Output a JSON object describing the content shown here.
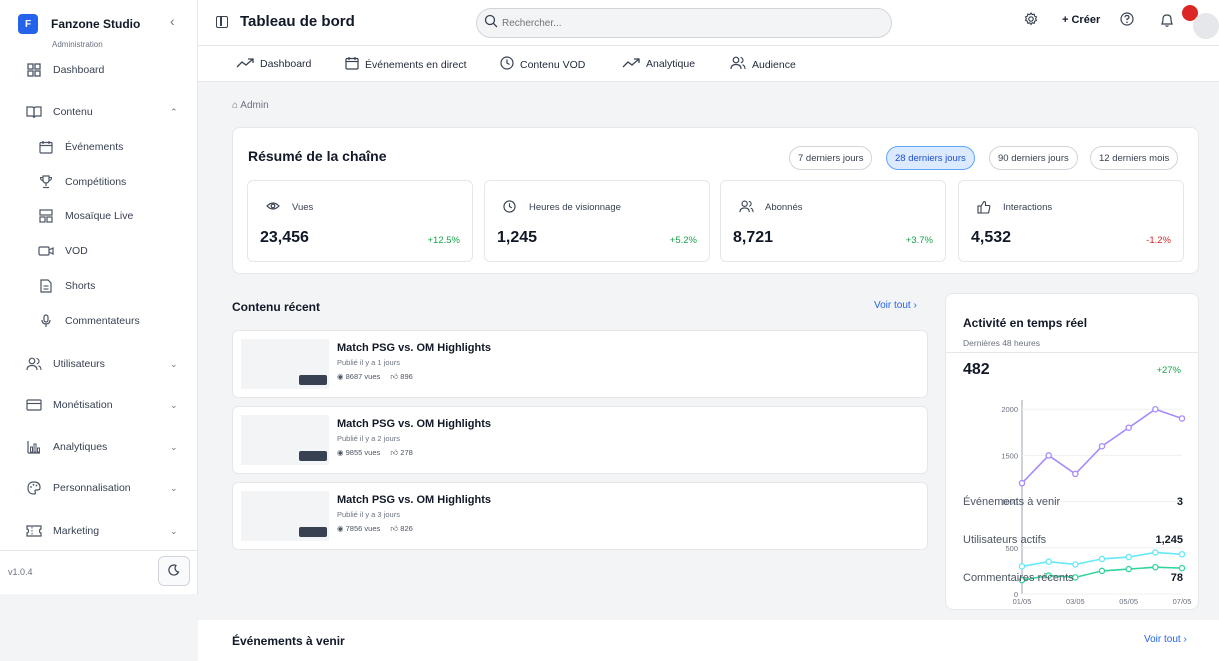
{
  "app": {
    "logo_letter": "F",
    "name": "Fanzone Studio",
    "subtitle": "Administration",
    "version": "v1.0.4"
  },
  "sidebar": {
    "items": [
      {
        "label": "Dashboard"
      },
      {
        "label": "Contenu"
      },
      {
        "label": "Événements"
      },
      {
        "label": "Compétitions"
      },
      {
        "label": "Mosaïque Live"
      },
      {
        "label": "VOD"
      },
      {
        "label": "Shorts"
      },
      {
        "label": "Commentateurs"
      },
      {
        "label": "Utilisateurs"
      },
      {
        "label": "Monétisation"
      },
      {
        "label": "Analytiques"
      },
      {
        "label": "Personnalisation"
      },
      {
        "label": "Marketing"
      }
    ]
  },
  "header": {
    "title": "Tableau de bord",
    "search_placeholder": "Rechercher...",
    "create_label": "+ Créer"
  },
  "tabs": [
    {
      "label": "Dashboard"
    },
    {
      "label": "Événements en direct"
    },
    {
      "label": "Contenu VOD"
    },
    {
      "label": "Analytique"
    },
    {
      "label": "Audience"
    }
  ],
  "breadcrumb": "Admin",
  "summary": {
    "title": "Résumé de la chaîne",
    "ranges": [
      "7 derniers jours",
      "28 derniers jours",
      "90 derniers jours",
      "12 derniers mois"
    ],
    "active_range": "28 derniers jours",
    "stats": [
      {
        "label": "Vues",
        "value": "23,456",
        "change": "+12.5%"
      },
      {
        "label": "Heures de visionnage",
        "value": "1,245",
        "change": "+5.2%"
      },
      {
        "label": "Abonnés",
        "value": "8,721",
        "change": "+3.7%"
      },
      {
        "label": "Interactions",
        "value": "4,532",
        "change": "-1.2%"
      }
    ]
  },
  "recent": {
    "title": "Contenu récent",
    "see_all": "Voir tout ›",
    "items": [
      {
        "title": "Match PSG vs. OM Highlights",
        "date": "Publié il y a 1 jours",
        "views": "8687 vues",
        "likes": "896"
      },
      {
        "title": "Match PSG vs. OM Highlights",
        "date": "Publié il y a 2 jours",
        "views": "9855 vues",
        "likes": "278"
      },
      {
        "title": "Match PSG vs. OM Highlights",
        "date": "Publié il y a 3 jours",
        "views": "7856 vues",
        "likes": "826"
      }
    ]
  },
  "activity": {
    "title": "Activité en temps réel",
    "subtitle": "Dernières 48 heures",
    "value": "482",
    "change": "+27%",
    "rows": [
      {
        "label": "Événements à venir",
        "value": "3"
      },
      {
        "label": "Utilisateurs actifs",
        "value": "1,245"
      },
      {
        "label": "Commentaires récents",
        "value": "78"
      }
    ]
  },
  "upcoming": {
    "title": "Événements à venir",
    "see_all": "Voir tout ›"
  },
  "colors": {
    "accent": "#2563eb",
    "positive": "#16a34a",
    "negative": "#dc2626",
    "series_purple": "#a78bfa",
    "series_cyan": "#67e8f9",
    "series_green": "#34d399"
  },
  "chart_data": {
    "type": "line",
    "x": [
      "01/05",
      "02/05",
      "03/05",
      "04/05",
      "05/05",
      "06/05",
      "07/05"
    ],
    "x_tick_labels": [
      "01/05",
      "03/05",
      "05/05",
      "07/05"
    ],
    "y_tick_labels": [
      "0",
      "500",
      "1000",
      "1500",
      "2000"
    ],
    "ylim": [
      0,
      2100
    ],
    "series": [
      {
        "values": [
          1200,
          1500,
          1300,
          1600,
          1800,
          2000,
          1900
        ]
      },
      {
        "values": [
          300,
          350,
          320,
          380,
          400,
          450,
          430
        ]
      },
      {
        "values": [
          150,
          200,
          180,
          250,
          270,
          290,
          280
        ]
      }
    ]
  }
}
